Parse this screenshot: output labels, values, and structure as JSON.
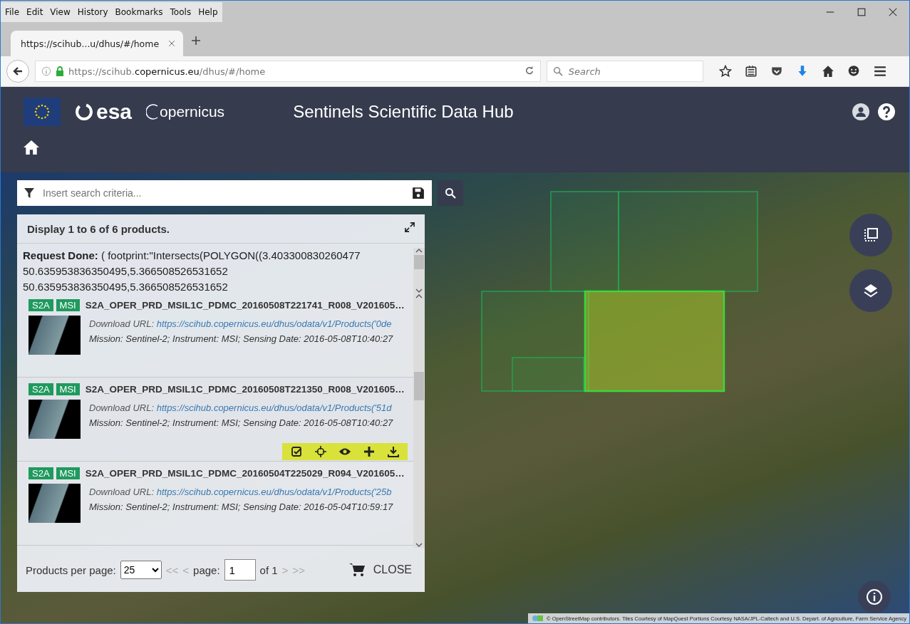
{
  "menu": [
    "File",
    "Edit",
    "View",
    "History",
    "Bookmarks",
    "Tools",
    "Help"
  ],
  "tabs": [
    {
      "label": "https://scihub...u/dhus/#/home",
      "selected": true
    }
  ],
  "address": {
    "prefix": "https://scihub.",
    "domain": "copernicus.eu",
    "suffix": "/dhus/#/home"
  },
  "browser_search": {
    "placeholder": "Search"
  },
  "header": {
    "agency": "esa",
    "brand": "opernicus",
    "title": "Sentinels Scientific Data Hub"
  },
  "search": {
    "placeholder": "Insert search criteria..."
  },
  "results": {
    "summary": "Display 1 to 6 of 6 products.",
    "request": "**Request Done:** ( footprint:\"Intersects(POLYGON((3.403300830260477\n50.635953836350495,5.366508526531652\n50.635953836350495,5.366508526531652",
    "products": [
      {
        "badges": [
          "S2A",
          "MSI"
        ],
        "name": "S2A_OPER_PRD_MSIL1C_PDMC_20160508T221741_R008_V201605…",
        "url_label": "Download URL:",
        "url": "https://scihub.copernicus.eu/dhus/odata/v1/Products('0de",
        "details": "Mission: Sentinel-2; Instrument: MSI; Sensing Date: 2016-05-08T10:40:27",
        "hovered": false
      },
      {
        "badges": [
          "S2A",
          "MSI"
        ],
        "name": "S2A_OPER_PRD_MSIL1C_PDMC_20160508T221350_R008_V201605…",
        "url_label": "Download URL:",
        "url": "https://scihub.copernicus.eu/dhus/odata/v1/Products('51d",
        "details": "Mission: Sentinel-2; Instrument: MSI; Sensing Date: 2016-05-08T10:40:27",
        "hovered": true
      },
      {
        "badges": [
          "S2A",
          "MSI"
        ],
        "name": "S2A_OPER_PRD_MSIL1C_PDMC_20160504T225029_R094_V201605…",
        "url_label": "Download URL:",
        "url": "https://scihub.copernicus.eu/dhus/odata/v1/Products('25b",
        "details": "Mission: Sentinel-2; Instrument: MSI; Sensing Date: 2016-05-04T10:59:17",
        "hovered": false
      }
    ],
    "footer": {
      "per_page_label": "Products per page:",
      "per_page": "25",
      "first": "<<",
      "prev": "<",
      "page_label": "page:",
      "page": "1",
      "of": "of 1",
      "next": ">",
      "last": ">>",
      "close": "CLOSE"
    }
  },
  "attribution": "© OpenStreetMap contributors. Tiles Courtesy of MapQuest Portions Courtesy NASA/JPL-Caltech and U.S. Depart. of Agriculture, Farm Service Agency"
}
